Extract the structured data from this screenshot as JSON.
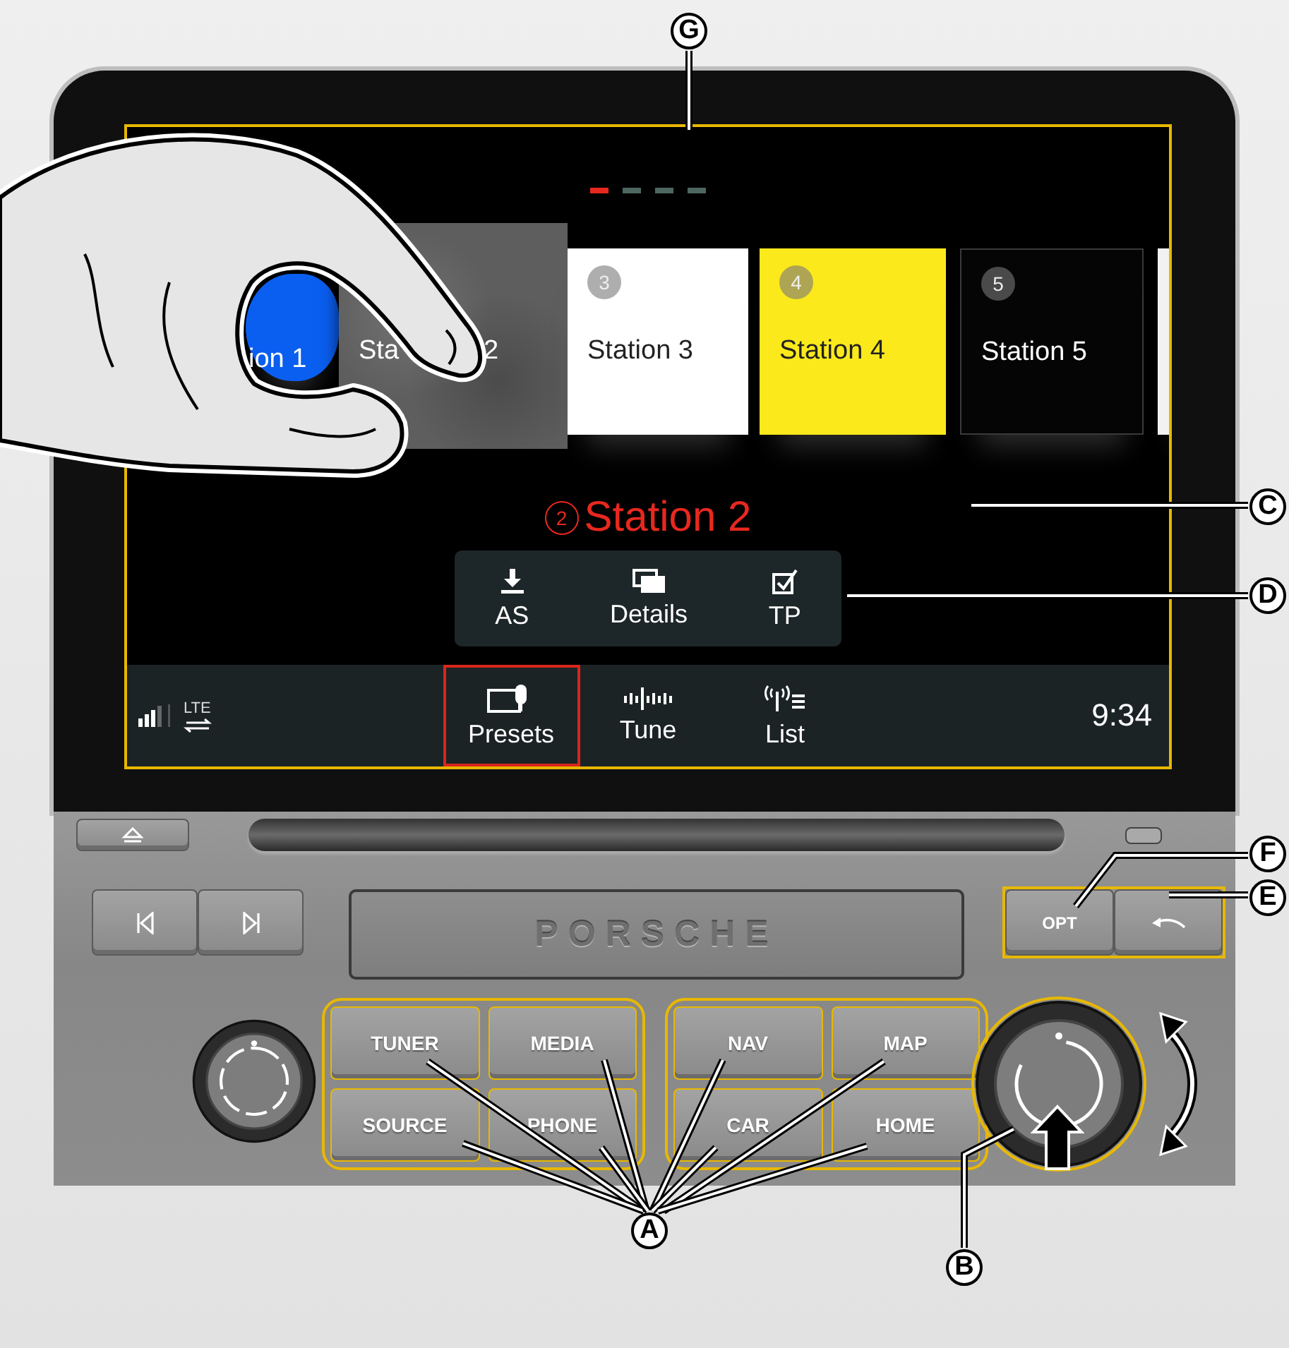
{
  "screen": {
    "page_dots": [
      {
        "selected": true
      },
      {
        "selected": false
      },
      {
        "selected": false
      },
      {
        "selected": false
      }
    ],
    "presets": [
      {
        "label_parts": [
          "ion 1"
        ],
        "color": "#0a5ff0",
        "selected": false
      },
      {
        "label_parts": [
          "Sta",
          "2"
        ],
        "color": "#5e5e5e",
        "selected": true
      },
      {
        "number": "3",
        "label_parts": [
          "Station 3"
        ],
        "color": "#ffffff",
        "selected": false
      },
      {
        "number": "4",
        "label_parts": [
          "Station 4"
        ],
        "color": "#fce91c",
        "selected": false
      },
      {
        "number": "5",
        "label_parts": [
          "Station 5"
        ],
        "color": "#050505",
        "selected": false
      },
      {
        "color": "#f2f2f2",
        "selected": false
      }
    ],
    "current_station": {
      "number": "2",
      "name": "Station 2"
    },
    "actions": [
      {
        "kind": "download",
        "label": "AS"
      },
      {
        "kind": "details",
        "label": "Details"
      },
      {
        "kind": "checkbox",
        "label": "TP"
      }
    ],
    "status": {
      "network": "LTE"
    },
    "tabs": [
      {
        "kind": "presets",
        "label": "Presets",
        "selected": true
      },
      {
        "kind": "tune",
        "label": "Tune",
        "selected": false
      },
      {
        "kind": "list",
        "label": "List",
        "selected": false
      }
    ],
    "time": "9:34"
  },
  "panel": {
    "brand": "PORSCHE",
    "option_button": "OPT",
    "buttons_left": [
      "TUNER",
      "MEDIA",
      "SOURCE",
      "PHONE"
    ],
    "buttons_right": [
      "NAV",
      "MAP",
      "CAR",
      "HOME"
    ]
  },
  "callouts": [
    {
      "letter": "G"
    },
    {
      "letter": "C"
    },
    {
      "letter": "D"
    },
    {
      "letter": "F"
    },
    {
      "letter": "E"
    },
    {
      "letter": "A"
    },
    {
      "letter": "B"
    }
  ]
}
